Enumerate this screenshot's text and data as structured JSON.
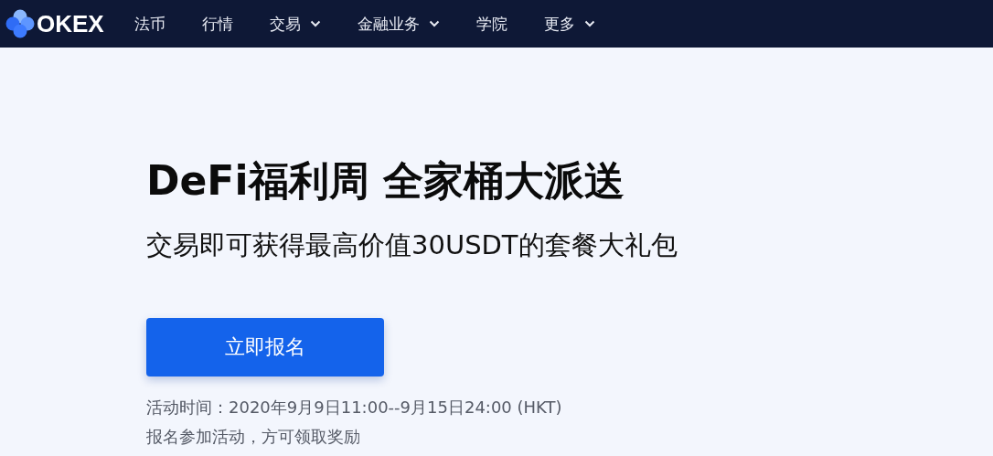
{
  "logo": {
    "text": "OKEX"
  },
  "nav": [
    {
      "label": "法币",
      "dropdown": false
    },
    {
      "label": "行情",
      "dropdown": false
    },
    {
      "label": "交易",
      "dropdown": true
    },
    {
      "label": "金融业务",
      "dropdown": true
    },
    {
      "label": "学院",
      "dropdown": false
    },
    {
      "label": "更多",
      "dropdown": true
    }
  ],
  "hero": {
    "title": "DeFi福利周 全家桶大派送",
    "subtitle": "交易即可获得最高价值30USDT的套餐大礼包",
    "button": "立即报名",
    "notes": [
      "活动时间：2020年9月9日11:00--9月15日24:00 (HKT)",
      "报名参加活动，方可领取奖励"
    ]
  }
}
